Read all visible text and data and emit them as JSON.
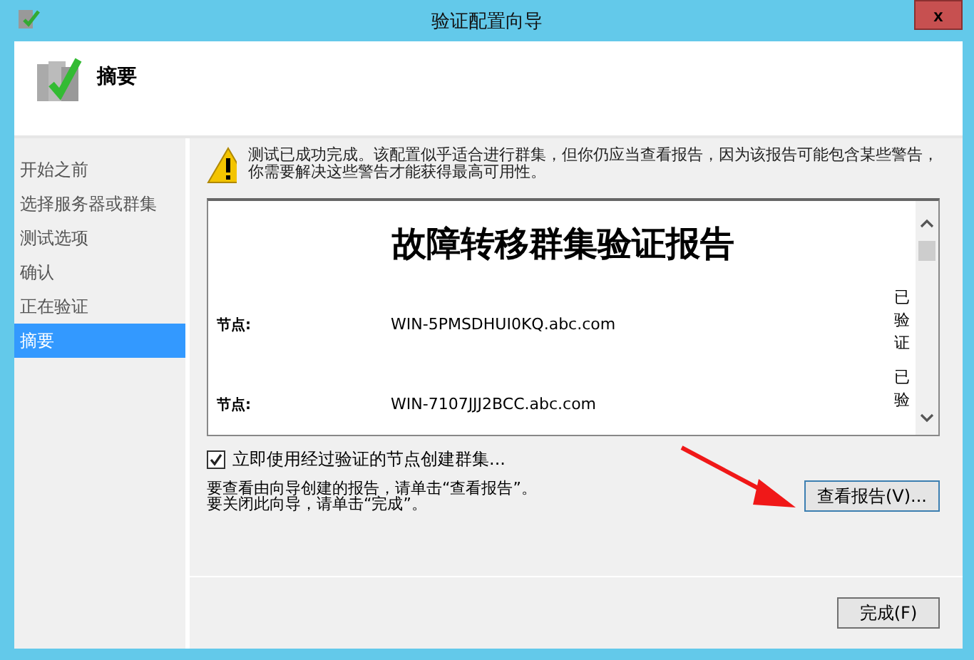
{
  "window": {
    "title": "验证配置向导",
    "close": "x"
  },
  "header": {
    "title": "摘要"
  },
  "sidebar": {
    "items": [
      {
        "label": "开始之前",
        "selected": false
      },
      {
        "label": "选择服务器或群集",
        "selected": false
      },
      {
        "label": "测试选项",
        "selected": false
      },
      {
        "label": "确认",
        "selected": false
      },
      {
        "label": "正在验证",
        "selected": false
      },
      {
        "label": "摘要",
        "selected": true
      }
    ]
  },
  "message": "测试已成功完成。该配置似乎适合进行群集，但你仍应当查看报告，因为该报告可能包含某些警告，你需要解决这些警告才能获得最高可用性。",
  "report": {
    "title": "故障转移群集验证报告",
    "rows": [
      {
        "label": "节点:",
        "value": "WIN-5PMSDHUI0KQ.abc.com",
        "status": "已验证"
      },
      {
        "label": "节点:",
        "value": "WIN-7107JJJ2BCC.abc.com",
        "status": "已验"
      }
    ]
  },
  "create_cluster": {
    "label": "立即使用经过验证的节点创建群集...",
    "checked": true
  },
  "hints": [
    "要查看由向导创建的报告，请单击“查看报告”。",
    "要关闭此向导，请单击“完成”。"
  ],
  "view_report_button": "查看报告(V)...",
  "finish_button": "完成(F)"
}
